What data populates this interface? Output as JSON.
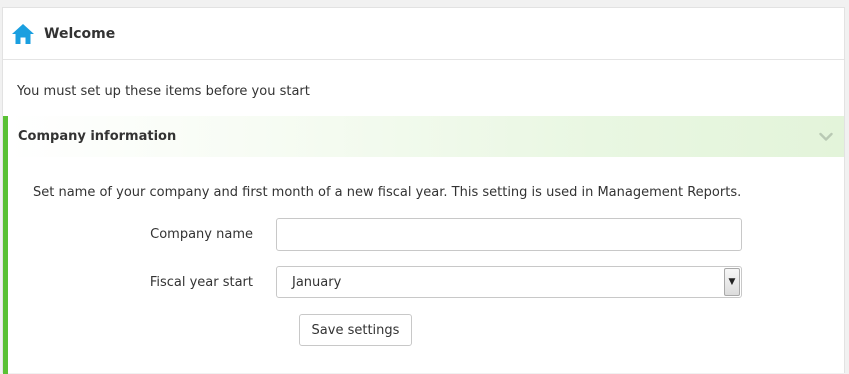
{
  "header": {
    "title": "Welcome",
    "icon": "home-icon",
    "accent_color": "#1a9fe0"
  },
  "intro": {
    "text": "You must set up these items before you start"
  },
  "company_section": {
    "title": "Company information",
    "collapse_icon": "chevron-down-icon",
    "accent_color": "#5ac134",
    "description": "Set name of your company and first month of a new fiscal year. This setting is used in Management Reports.",
    "company_name_label": "Company name",
    "company_name_value": "",
    "fiscal_year_label": "Fiscal year start",
    "fiscal_year_selected": "January",
    "save_label": "Save settings"
  }
}
